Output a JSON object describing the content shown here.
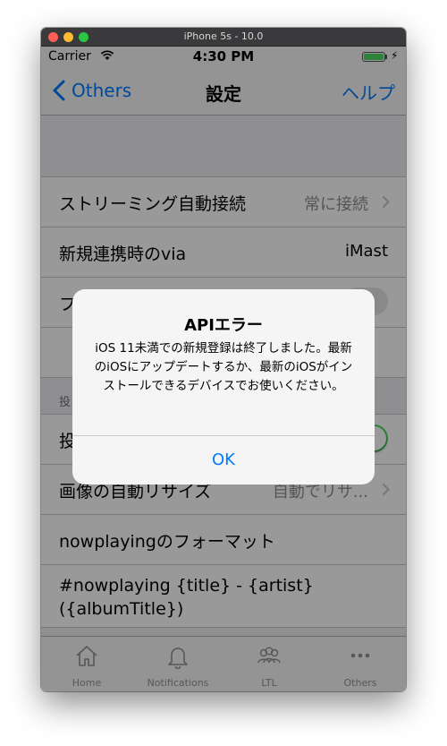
{
  "simulator": {
    "title": "iPhone 5s - 10.0"
  },
  "status_bar": {
    "carrier": "Carrier",
    "time": "4:30 PM",
    "battery_color": "#4cd964"
  },
  "nav": {
    "back_label": "Others",
    "title": "設定",
    "right_label": "ヘルプ"
  },
  "settings": {
    "streaming": {
      "label": "ストリーミング自動接続",
      "value": "常に接続"
    },
    "via": {
      "label": "新規連携時のvia",
      "value": "iMast"
    },
    "row3_label": "フ",
    "section_header": "投",
    "row5_label": "投",
    "resize": {
      "label": "画像の自動リサイズ",
      "value": "自動でリサ..."
    },
    "nowplaying_format_label": "nowplayingのフォーマット",
    "nowplaying_template": "#nowplaying {title} - {artist} ({albumTitle})"
  },
  "tabs": [
    {
      "label": "Home",
      "icon": "home-icon"
    },
    {
      "label": "Notifications",
      "icon": "bell-icon"
    },
    {
      "label": "LTL",
      "icon": "people-icon"
    },
    {
      "label": "Others",
      "icon": "more-icon"
    }
  ],
  "alert": {
    "title": "APIエラー",
    "message": "iOS 11未満での新規登録は終了しました。最新のiOSにアップデートするか、最新のiOSがインストールできるデバイスでお使いください。",
    "ok_label": "OK"
  },
  "colors": {
    "accent": "#007aff",
    "switch_on": "#4cd964"
  }
}
